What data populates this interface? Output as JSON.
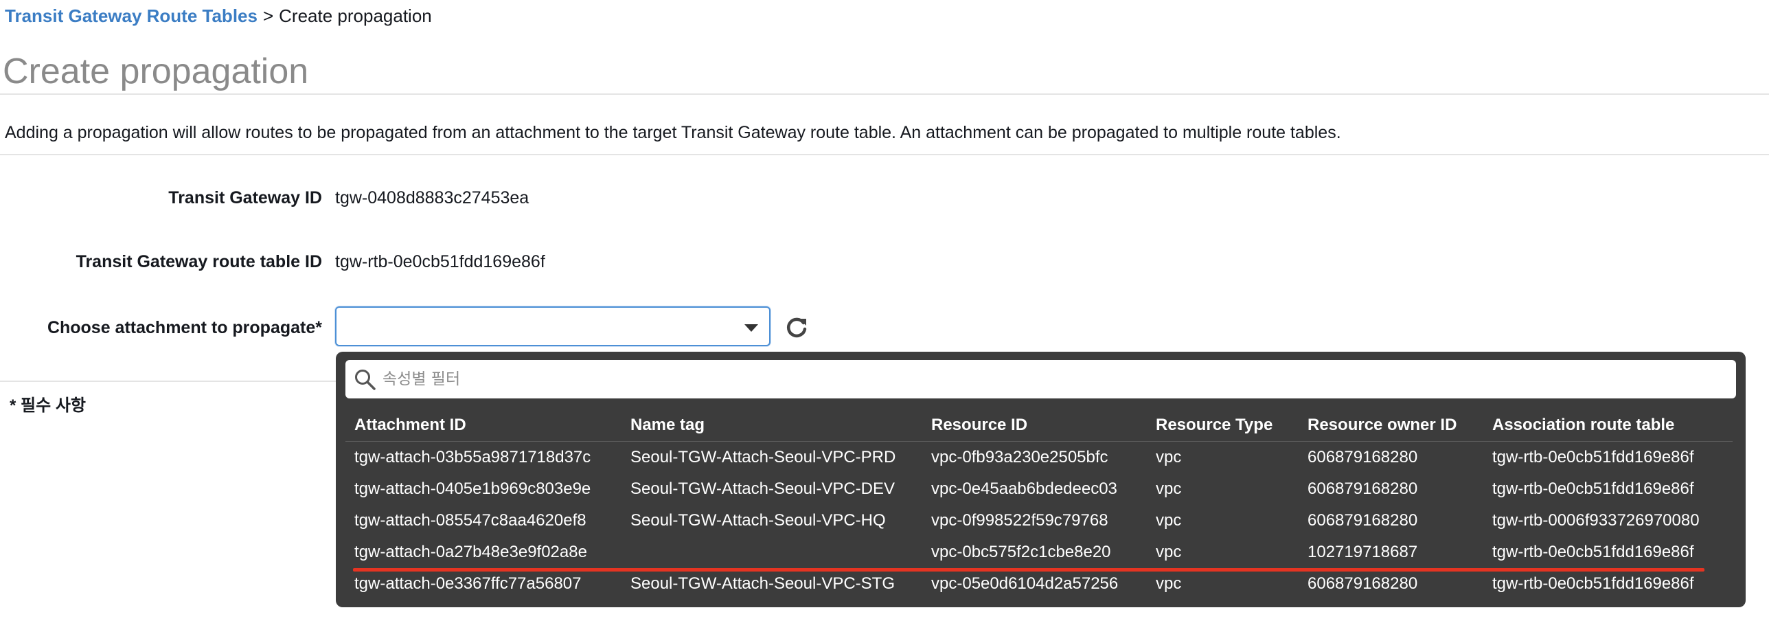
{
  "breadcrumb": {
    "parent": "Transit Gateway Route Tables",
    "separator": ">",
    "current": "Create propagation"
  },
  "page": {
    "title": "Create propagation",
    "description": "Adding a propagation will allow routes to be propagated from an attachment to the target Transit Gateway route table. An attachment can be propagated to multiple route tables."
  },
  "form": {
    "tgw_id_label": "Transit Gateway ID",
    "tgw_id_value": "tgw-0408d8883c27453ea",
    "route_table_label": "Transit Gateway route table ID",
    "route_table_value": "tgw-rtb-0e0cb51fdd169e86f",
    "choose_label": "Choose attachment to propagate*",
    "choose_value": "",
    "required_note": "* 필수 사항"
  },
  "dropdown": {
    "filter_placeholder": "속성별 필터",
    "columns": {
      "attachment_id": "Attachment ID",
      "name_tag": "Name tag",
      "resource_id": "Resource ID",
      "resource_type": "Resource Type",
      "owner_id": "Resource owner ID",
      "assoc_route_table": "Association route table"
    },
    "rows": [
      {
        "attachment_id": "tgw-attach-03b55a9871718d37c",
        "name_tag": "Seoul-TGW-Attach-Seoul-VPC-PRD",
        "resource_id": "vpc-0fb93a230e2505bfc",
        "resource_type": "vpc",
        "owner_id": "606879168280",
        "assoc_route_table": "tgw-rtb-0e0cb51fdd169e86f"
      },
      {
        "attachment_id": "tgw-attach-0405e1b969c803e9e",
        "name_tag": "Seoul-TGW-Attach-Seoul-VPC-DEV",
        "resource_id": "vpc-0e45aab6bdedeec03",
        "resource_type": "vpc",
        "owner_id": "606879168280",
        "assoc_route_table": "tgw-rtb-0e0cb51fdd169e86f"
      },
      {
        "attachment_id": "tgw-attach-085547c8aa4620ef8",
        "name_tag": "Seoul-TGW-Attach-Seoul-VPC-HQ",
        "resource_id": "vpc-0f998522f59c79768",
        "resource_type": "vpc",
        "owner_id": "606879168280",
        "assoc_route_table": "tgw-rtb-0006f933726970080"
      },
      {
        "attachment_id": "tgw-attach-0a27b48e3e9f02a8e",
        "name_tag": "",
        "resource_id": "vpc-0bc575f2c1cbe8e20",
        "resource_type": "vpc",
        "owner_id": "102719718687",
        "assoc_route_table": "tgw-rtb-0e0cb51fdd169e86f"
      },
      {
        "attachment_id": "tgw-attach-0e3367ffc77a56807",
        "name_tag": "Seoul-TGW-Attach-Seoul-VPC-STG",
        "resource_id": "vpc-05e0d6104d2a57256",
        "resource_type": "vpc",
        "owner_id": "606879168280",
        "assoc_route_table": "tgw-rtb-0e0cb51fdd169e86f"
      }
    ]
  },
  "icons": {
    "dropdown": "caret-down-icon",
    "refresh": "refresh-icon",
    "search": "search-icon"
  },
  "colors": {
    "link": "#3b7dc4",
    "title": "#8a8a8a",
    "select_border": "#4d90d6",
    "dropdown_bg": "#3c3c3c",
    "highlight": "#e53422"
  }
}
